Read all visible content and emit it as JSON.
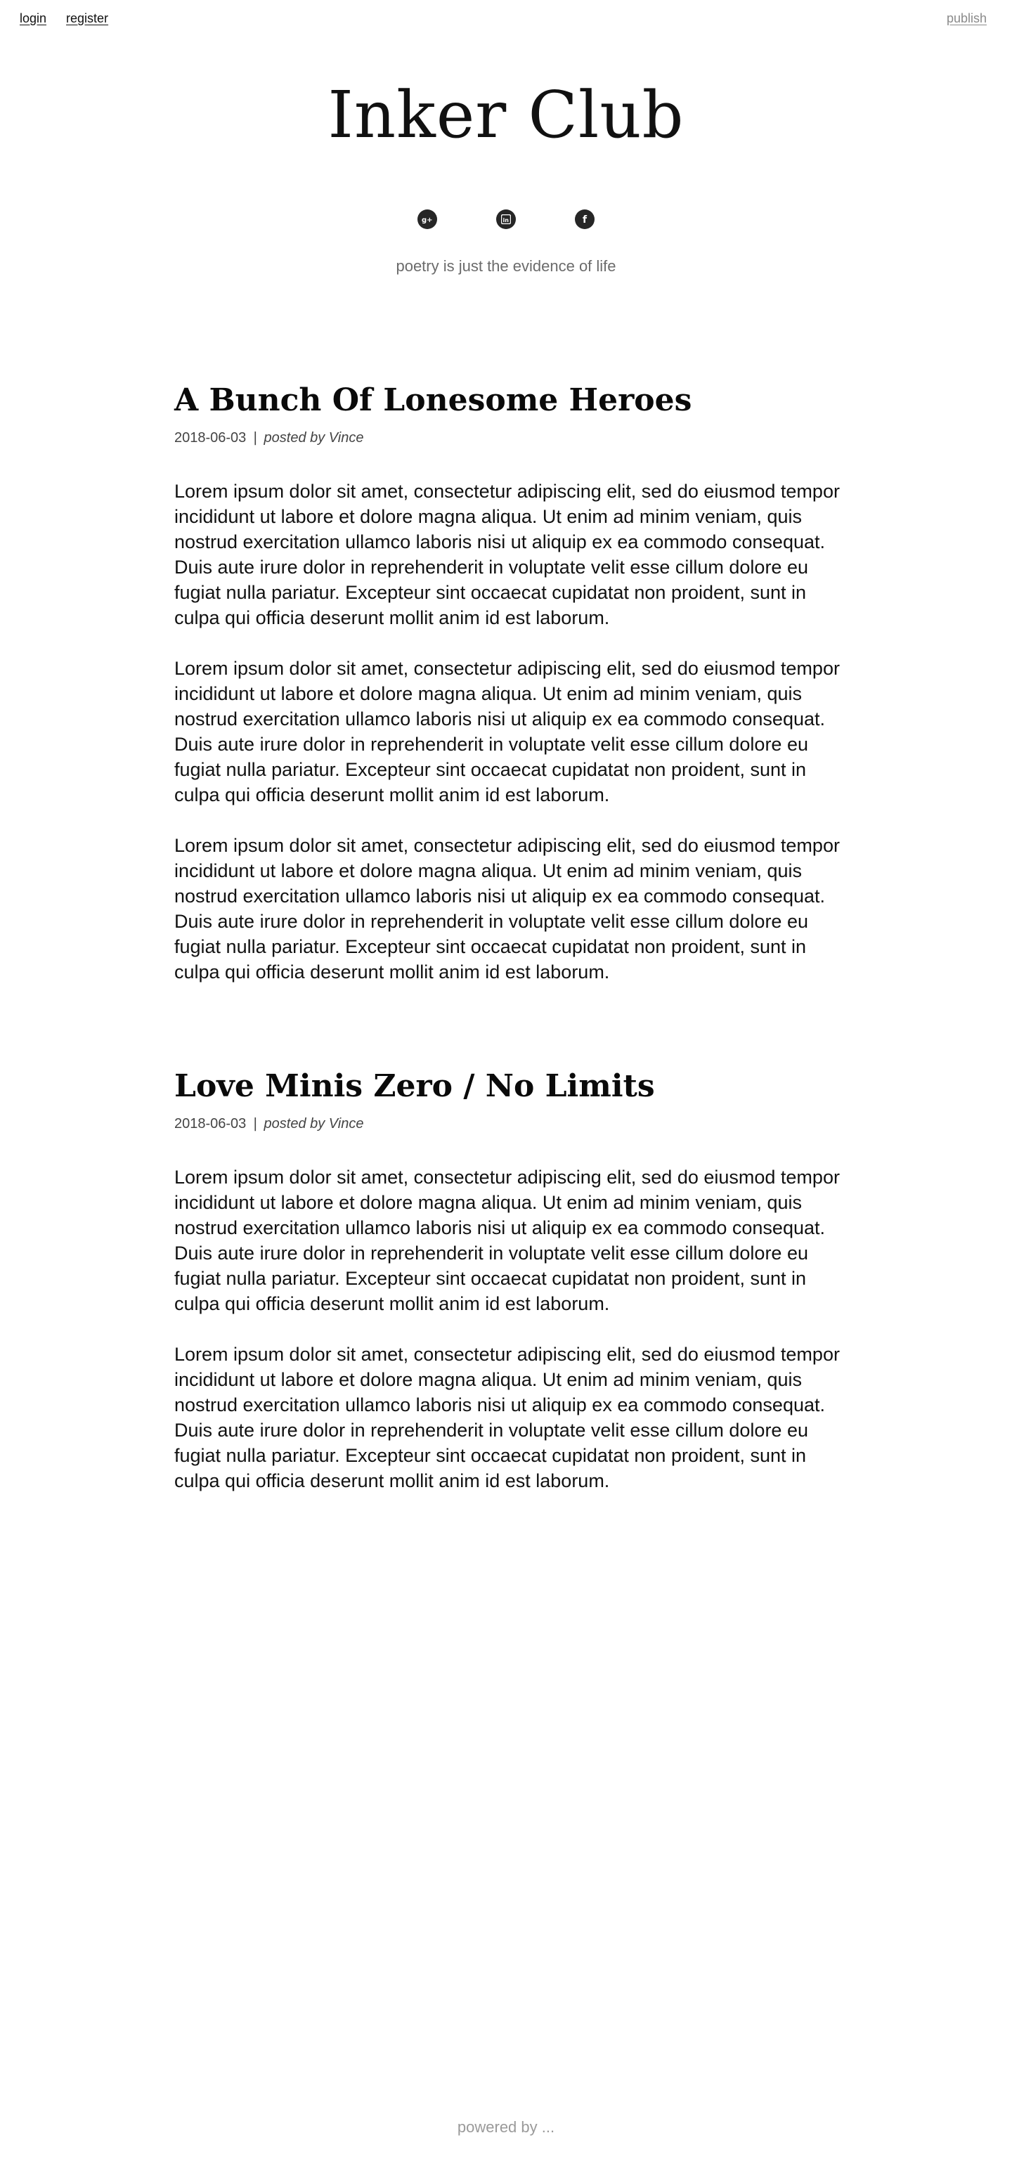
{
  "nav": {
    "login": "login",
    "register": "register",
    "publish": "publish"
  },
  "site": {
    "title": "Inker Club",
    "tagline": "poetry is just the evidence of life",
    "social": [
      {
        "icon": "google-plus-icon",
        "glyph": "g+"
      },
      {
        "icon": "linkedin-icon",
        "glyph": "in"
      },
      {
        "icon": "facebook-icon",
        "glyph": "f"
      }
    ]
  },
  "posts": [
    {
      "title": "A Bunch Of Lonesome Heroes",
      "date": "2018-06-03",
      "separator": "|",
      "author": "posted by Vince",
      "paragraphs": [
        "Lorem ipsum dolor sit amet, consectetur adipiscing elit, sed do eiusmod tempor incididunt ut labore et dolore magna aliqua. Ut enim ad minim veniam, quis nostrud exercitation ullamco laboris nisi ut aliquip ex ea commodo consequat. Duis aute irure dolor in reprehenderit in voluptate velit esse cillum dolore eu fugiat nulla pariatur. Excepteur sint occaecat cupidatat non proident, sunt in culpa qui officia deserunt mollit anim id est laborum.",
        "Lorem ipsum dolor sit amet, consectetur adipiscing elit, sed do eiusmod tempor incididunt ut labore et dolore magna aliqua. Ut enim ad minim veniam, quis nostrud exercitation ullamco laboris nisi ut aliquip ex ea commodo consequat. Duis aute irure dolor in reprehenderit in voluptate velit esse cillum dolore eu fugiat nulla pariatur. Excepteur sint occaecat cupidatat non proident, sunt in culpa qui officia deserunt mollit anim id est laborum.",
        "Lorem ipsum dolor sit amet, consectetur adipiscing elit, sed do eiusmod tempor incididunt ut labore et dolore magna aliqua. Ut enim ad minim veniam, quis nostrud exercitation ullamco laboris nisi ut aliquip ex ea commodo consequat. Duis aute irure dolor in reprehenderit in voluptate velit esse cillum dolore eu fugiat nulla pariatur. Excepteur sint occaecat cupidatat non proident, sunt in culpa qui officia deserunt mollit anim id est laborum."
      ]
    },
    {
      "title": "Love Minis Zero / No Limits",
      "date": "2018-06-03",
      "separator": "|",
      "author": "posted by Vince",
      "paragraphs": [
        "Lorem ipsum dolor sit amet, consectetur adipiscing elit, sed do eiusmod tempor incididunt ut labore et dolore magna aliqua. Ut enim ad minim veniam, quis nostrud exercitation ullamco laboris nisi ut aliquip ex ea commodo consequat. Duis aute irure dolor in reprehenderit in voluptate velit esse cillum dolore eu fugiat nulla pariatur. Excepteur sint occaecat cupidatat non proident, sunt in culpa qui officia deserunt mollit anim id est laborum.",
        "Lorem ipsum dolor sit amet, consectetur adipiscing elit, sed do eiusmod tempor incididunt ut labore et dolore magna aliqua. Ut enim ad minim veniam, quis nostrud exercitation ullamco laboris nisi ut aliquip ex ea commodo consequat. Duis aute irure dolor in reprehenderit in voluptate velit esse cillum dolore eu fugiat nulla pariatur. Excepteur sint occaecat cupidatat non proident, sunt in culpa qui officia deserunt mollit anim id est laborum."
      ]
    }
  ],
  "footer": {
    "text": "powered by ..."
  }
}
